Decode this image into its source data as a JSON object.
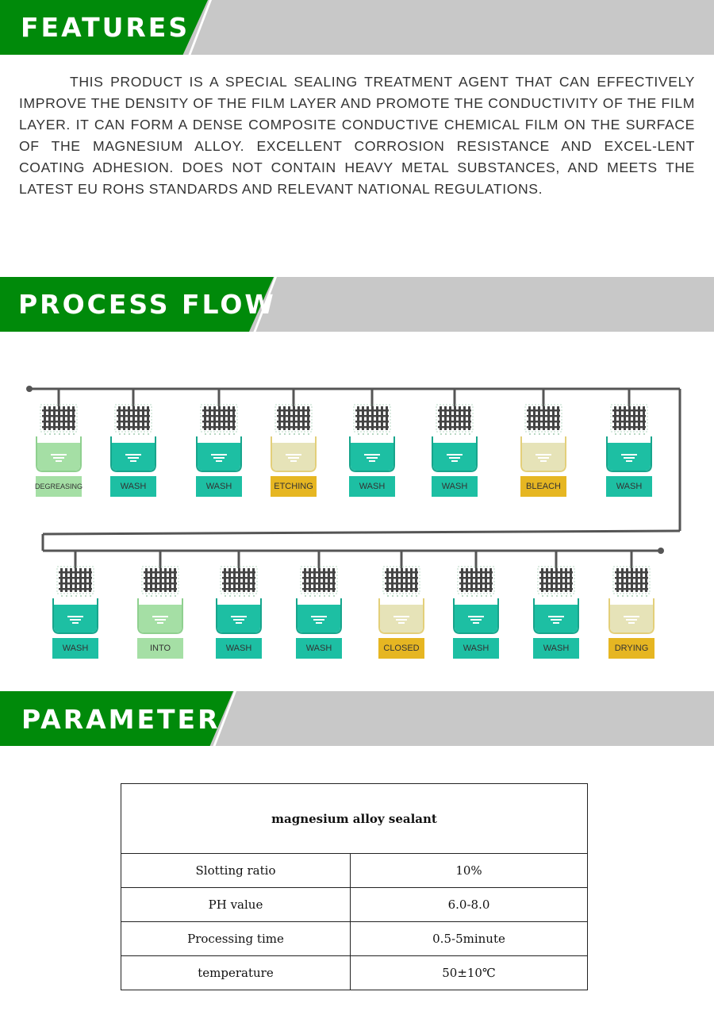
{
  "sections": {
    "features": {
      "title": "FEATURES",
      "text": "THIS PRODUCT IS A SPECIAL SEALING TREATMENT AGENT THAT CAN EFFECTIVELY IMPROVE THE DENSITY OF THE FILM LAYER AND PROMOTE THE CONDUCTIVITY OF THE FILM LAYER. IT CAN FORM A DENSE COMPOSITE CONDUCTIVE CHEMICAL FILM ON THE SURFACE OF THE MAGNESIUM ALLOY. EXCELLENT CORROSION RESISTANCE AND EXCEL-LENT COATING ADHESION. DOES NOT CONTAIN HEAVY METAL SUBSTANCES, AND MEETS THE LATEST EU ROHS STANDARDS AND RELEVANT NATIONAL REGULATIONS."
    },
    "process_flow": {
      "title": "PROCESS FLOW",
      "colors": {
        "teal": "#1dbfa3",
        "light_green": "#a5dfa5",
        "pale_yellow": "#e6e3b8",
        "gold": "#e6b622",
        "rail": "#555555"
      },
      "row1": [
        {
          "label": "DEGREASING",
          "tank": "light_green",
          "tag": "light_green"
        },
        {
          "label": "WASH",
          "tank": "teal",
          "tag": "teal"
        },
        {
          "label": "WASH",
          "tank": "teal",
          "tag": "teal"
        },
        {
          "label": "ETCHING",
          "tank": "pale_yellow",
          "tag": "gold"
        },
        {
          "label": "WASH",
          "tank": "teal",
          "tag": "teal"
        },
        {
          "label": "WASH",
          "tank": "teal",
          "tag": "teal"
        },
        {
          "label": "BLEACH",
          "tank": "pale_yellow",
          "tag": "gold"
        },
        {
          "label": "WASH",
          "tank": "teal",
          "tag": "teal"
        }
      ],
      "row2": [
        {
          "label": "WASH",
          "tank": "teal",
          "tag": "teal"
        },
        {
          "label": "INTO",
          "tank": "light_green",
          "tag": "light_green"
        },
        {
          "label": "WASH",
          "tank": "teal",
          "tag": "teal"
        },
        {
          "label": "WASH",
          "tank": "teal",
          "tag": "teal"
        },
        {
          "label": "CLOSED",
          "tank": "pale_yellow",
          "tag": "gold"
        },
        {
          "label": "WASH",
          "tank": "teal",
          "tag": "teal"
        },
        {
          "label": "WASH",
          "tank": "teal",
          "tag": "teal"
        },
        {
          "label": "DRYING",
          "tank": "pale_yellow",
          "tag": "gold"
        }
      ]
    },
    "parameter": {
      "title": "PARAMETER",
      "table": {
        "header": "magnesium alloy sealant",
        "rows": [
          {
            "name": "Slotting ratio",
            "value": "10%"
          },
          {
            "name": "PH value",
            "value": "6.0-8.0"
          },
          {
            "name": "Processing time",
            "value": "0.5-5minute"
          },
          {
            "name": "temperature",
            "value": "50±10℃"
          }
        ]
      }
    }
  },
  "theme": {
    "banner_green": "#008a0a",
    "banner_gray": "#c8c8c8"
  }
}
